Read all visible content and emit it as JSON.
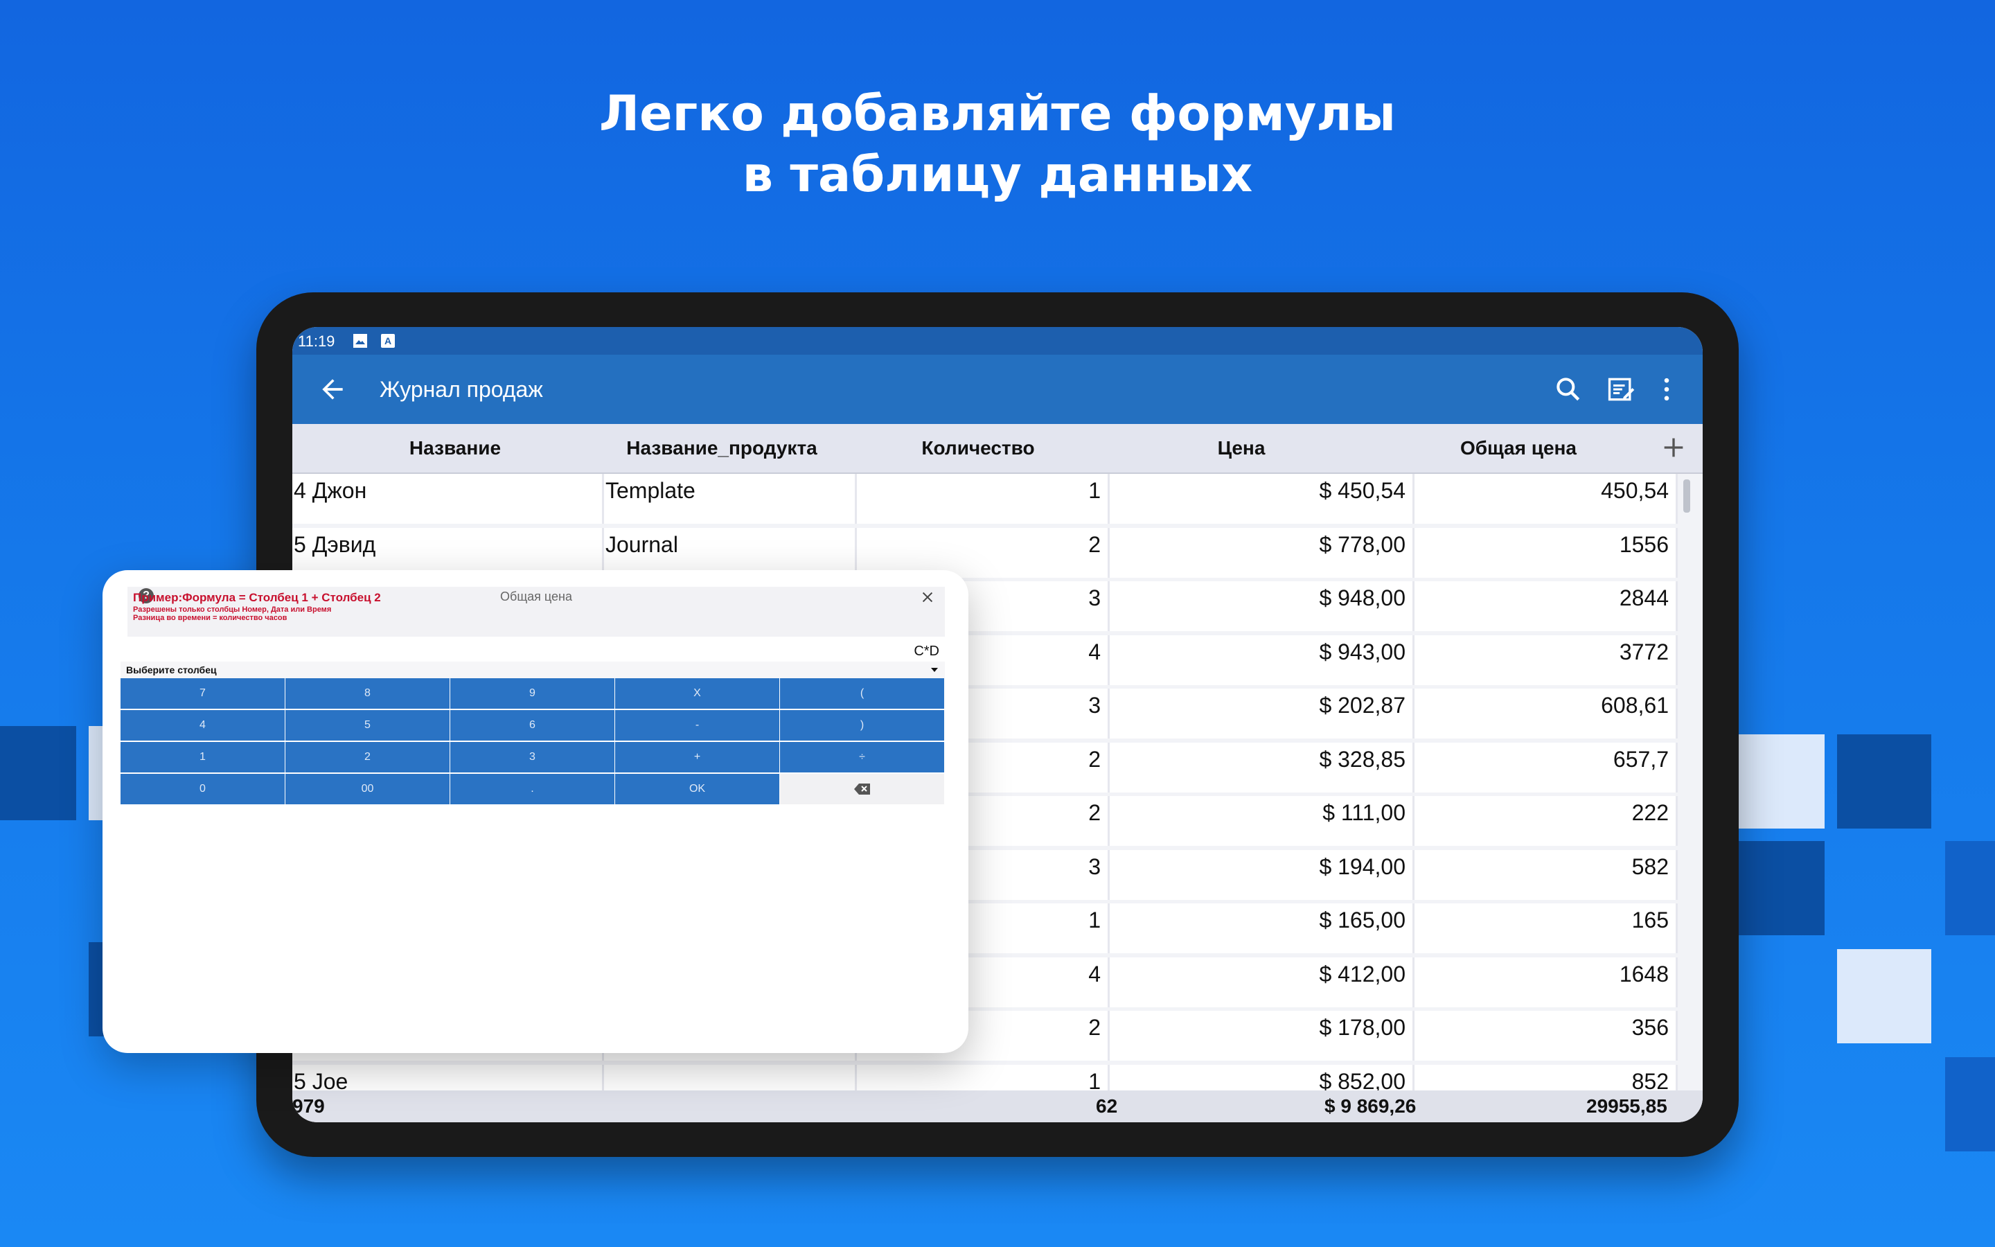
{
  "headline": {
    "line1": "Легко добавляйте формулы",
    "line2": "в таблицу данных"
  },
  "status_bar": {
    "time": "11:19",
    "icons": [
      "image-icon",
      "a-icon"
    ],
    "a_glyph": "A"
  },
  "app_bar": {
    "title": "Журнал продаж",
    "icons": [
      "back-arrow-icon",
      "search-icon",
      "edit-note-icon",
      "more-vert-icon"
    ]
  },
  "table": {
    "columns": [
      "Название",
      "Название_продукта",
      "Количество",
      "Цена",
      "Общая цена"
    ],
    "rows": [
      [
        "4 Джон",
        "Template",
        "1",
        "$ 450,54",
        "450,54"
      ],
      [
        "5 Дэвид",
        "Journal",
        "2",
        "$ 778,00",
        "1556"
      ],
      [
        "",
        "",
        "3",
        "$ 948,00",
        "2844"
      ],
      [
        "",
        "",
        "4",
        "$ 943,00",
        "3772"
      ],
      [
        "",
        "",
        "3",
        "$ 202,87",
        "608,61"
      ],
      [
        "",
        "",
        "2",
        "$ 328,85",
        "657,7"
      ],
      [
        "",
        "",
        "2",
        "$ 111,00",
        "222"
      ],
      [
        "",
        "",
        "3",
        "$ 194,00",
        "582"
      ],
      [
        "",
        "",
        "1",
        "$ 165,00",
        "165"
      ],
      [
        "",
        "",
        "4",
        "$ 412,00",
        "1648"
      ],
      [
        "",
        "",
        "2",
        "$ 178,00",
        "356"
      ],
      [
        "5 Joe",
        "",
        "1",
        "$ 852,00",
        "852"
      ]
    ],
    "footer": {
      "id_total": "979",
      "quantity_total": "62",
      "price_total": "$ 9 869,26",
      "total_price_total": "29955,85"
    }
  },
  "dialog": {
    "title": "Общая цена",
    "example": "Пример:Формула = Столбец 1 + Столбец 2",
    "note1": "Разрешены только столбцы Номер, Дата или Время",
    "note2": "Разница во времени = количество часов",
    "formula": "C*D",
    "select_label": "Выберите столбец",
    "keys": [
      [
        "7",
        "8",
        "9",
        "X",
        "("
      ],
      [
        "4",
        "5",
        "6",
        "-",
        ")"
      ],
      [
        "1",
        "2",
        "3",
        "+",
        "÷"
      ],
      [
        "0",
        "00",
        ".",
        "OK",
        ""
      ]
    ]
  },
  "colors": {
    "background": "#1578ea",
    "app_bar": "#2470c0",
    "status_bar": "#1d5fae",
    "keypad": "#2a73c4",
    "example_text": "#c8102e"
  }
}
